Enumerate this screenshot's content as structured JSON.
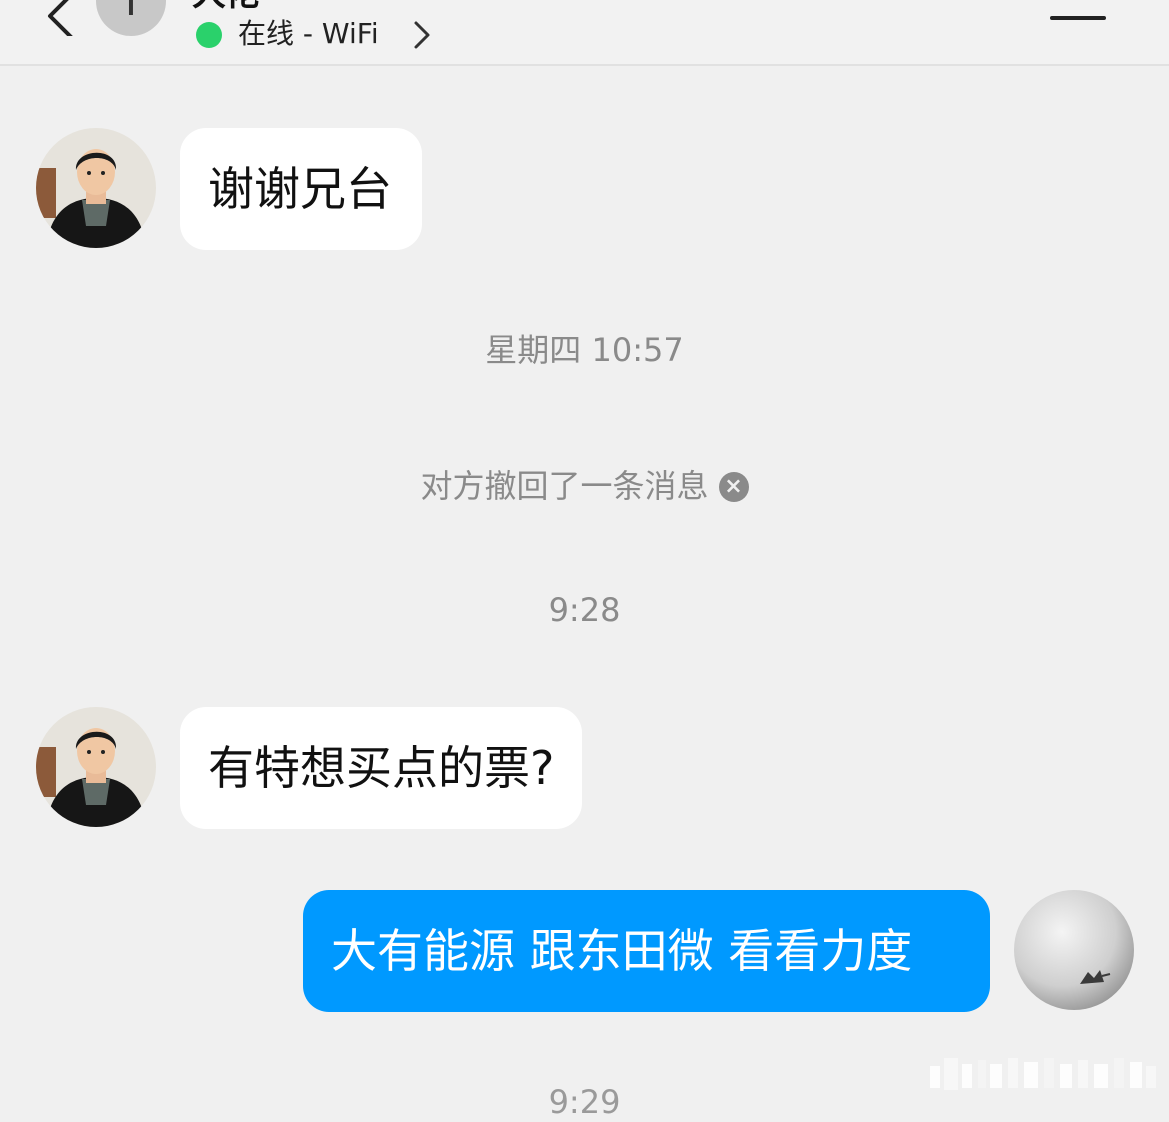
{
  "header": {
    "contact_name": "大佬",
    "avatar_letter": "T",
    "status_text": "在线 - WiFi",
    "online_color": "#2ad16b",
    "icons": [
      "back-icon",
      "chevron-right-icon",
      "menu-icon"
    ]
  },
  "messages": [
    {
      "type": "incoming",
      "text": "谢谢兄台"
    },
    {
      "type": "timestamp",
      "text": "星期四 10:57"
    },
    {
      "type": "system",
      "text": "对方撤回了一条消息",
      "close_glyph": "×"
    },
    {
      "type": "timestamp",
      "text": "9:28"
    },
    {
      "type": "incoming",
      "text": "有特想买点的票?"
    },
    {
      "type": "outgoing",
      "text": "大有能源 跟东田微 看看力度"
    },
    {
      "type": "timestamp",
      "text": "9:29"
    }
  ],
  "colors": {
    "background": "#f0f0f0",
    "incoming_bubble": "#ffffff",
    "outgoing_bubble": "#0099ff",
    "timestamp_text": "#8a8a8a"
  }
}
